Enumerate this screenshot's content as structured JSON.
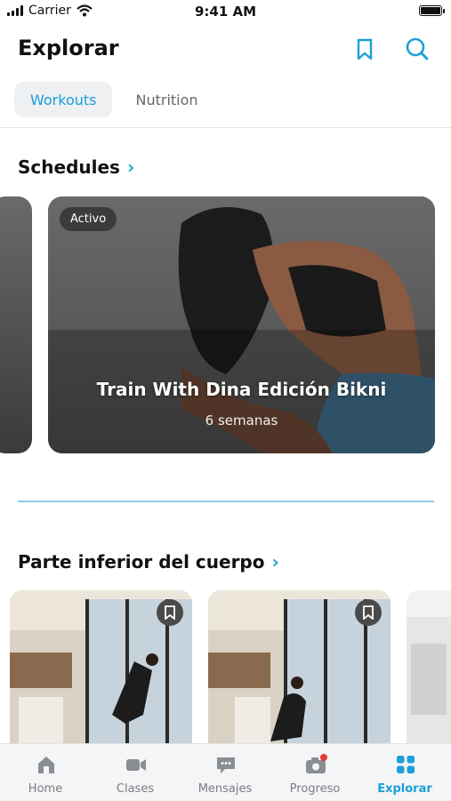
{
  "status_bar": {
    "carrier": "Carrier",
    "time": "9:41 AM"
  },
  "header": {
    "title": "Explorar",
    "bookmark_icon": "bookmark-icon",
    "search_icon": "search-icon"
  },
  "tabs": [
    {
      "label": "Workouts",
      "active": true
    },
    {
      "label": "Nutrition",
      "active": false
    }
  ],
  "schedules": {
    "title": "Schedules",
    "featured": {
      "badge": "Activo",
      "title": "Train With Dina Edición Bikni",
      "subtitle": "6 semanas"
    }
  },
  "lower_body": {
    "title": "Parte inferior del cuerpo"
  },
  "tab_bar": {
    "items": [
      {
        "label": "Home",
        "icon": "home-icon"
      },
      {
        "label": "Clases",
        "icon": "video-camera-icon"
      },
      {
        "label": "Mensajes",
        "icon": "chat-bubble-icon"
      },
      {
        "label": "Progreso",
        "icon": "camera-icon"
      },
      {
        "label": "Explorar",
        "icon": "grid-icon",
        "active": true
      }
    ]
  },
  "colors": {
    "accent": "#1aa0d8",
    "notification_dot": "#e53935"
  }
}
